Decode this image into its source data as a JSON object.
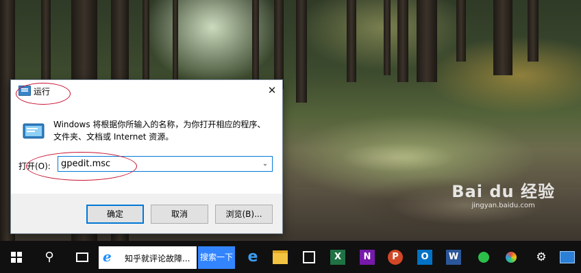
{
  "dialog": {
    "title": "运行",
    "description": "Windows 将根据你所输入的名称，为你打开相应的程序、文件夹、文档或 Internet 资源。",
    "open_label": "打开(O):",
    "open_value": "gpedit.msc",
    "ok_label": "确定",
    "cancel_label": "取消",
    "browse_label": "浏览(B)...",
    "close_glyph": "✕"
  },
  "taskbar": {
    "ie_task_label": "知乎就评论故障...",
    "search_button_label": "搜索一下",
    "apps": [
      {
        "name": "edge-icon",
        "glyph": "e"
      },
      {
        "name": "file-explorer-icon"
      },
      {
        "name": "store-icon"
      },
      {
        "name": "excel-icon",
        "glyph": "X",
        "color": "#1f7244"
      },
      {
        "name": "onenote-icon",
        "glyph": "N",
        "color": "#7719aa"
      },
      {
        "name": "powerpoint-icon",
        "glyph": "P",
        "color": "#d24726"
      },
      {
        "name": "outlook-icon",
        "glyph": "O",
        "color": "#0072c6"
      },
      {
        "name": "word-icon",
        "glyph": "W",
        "color": "#2b579a"
      }
    ]
  },
  "watermark": {
    "logo": "Bai du 经验",
    "url": "jingyan.baidu.com"
  },
  "colors": {
    "accent": "#0078d7",
    "annotation": "#c8102e",
    "taskbar": "#101010",
    "baidu_blue": "#3385ff"
  }
}
